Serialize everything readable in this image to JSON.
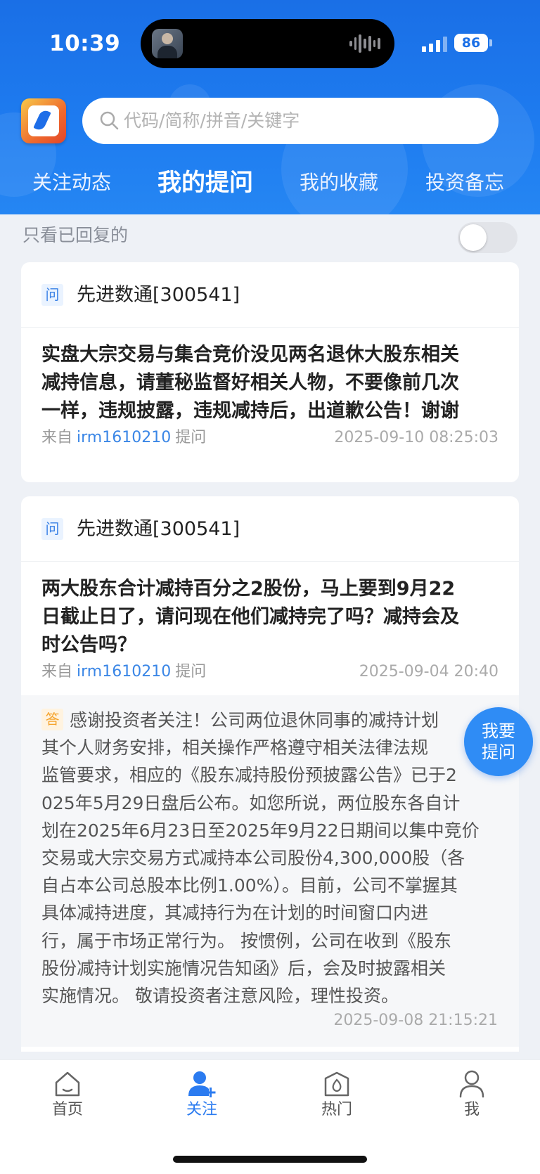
{
  "status_bar": {
    "time": "10:39",
    "battery": "86"
  },
  "search": {
    "placeholder": "代码/简称/拼音/关键字"
  },
  "tabs": [
    {
      "label": "关注动态"
    },
    {
      "label": "我的提问"
    },
    {
      "label": "我的收藏"
    },
    {
      "label": "投资备忘"
    }
  ],
  "filter": {
    "label": "只看已回复的",
    "enabled": false
  },
  "cards": [
    {
      "q_tag": "问",
      "company": "先进数通[300541]",
      "question_lines": [
        "实盘大宗交易与集合竞价没见两名退休大股东相关",
        "减持信息，请董秘监督好相关人物，不要像前几次",
        "一样，违规披露，违规减持后，出道歉公告！谢谢"
      ],
      "from_label": "来自",
      "user": "irm1610210",
      "action": "提问",
      "time": "2025-09-10 08:25:03"
    },
    {
      "q_tag": "问",
      "company": "先进数通[300541]",
      "question_lines": [
        "两大股东合计减持百分之2股份，马上要到9月22",
        "日截止日了，请问现在他们减持完了吗？减持会及",
        "时公告吗？"
      ],
      "from_label": "来自",
      "user": "irm1610210",
      "action": "提问",
      "time": "2025-09-04 20:40",
      "answer": {
        "tag": "答",
        "first": "感谢投资者关注！公司两位退休同事的减持计划",
        "lines": [
          "其个人财务安排，相关操作严格遵守相关法律法规",
          "监管要求，相应的《股东减持股份预披露公告》已于2",
          "025年5月29日盘后公布。如您所说，两位股东各自计",
          "划在2025年6月23日至2025年9月22日期间以集中竞价",
          "交易或大宗交易方式减持本公司股份4,300,000股（各",
          "自占本公司总股本比例1.00%）。目前，公司不掌握其",
          "具体减持进度，其减持行为在计划的时间窗口内进",
          "行，属于市场正常行为。 按惯例，公司在收到《股东",
          "股份减持计划实施情况告知函》后，会及时披露相关",
          "实施情况。 敬请投资者注意风险，理性投资。"
        ],
        "time": "2025-09-08 21:15:21"
      }
    }
  ],
  "fab": {
    "line1": "我要",
    "line2": "提问"
  },
  "bottom_nav": [
    {
      "label": "首页",
      "icon": "home-icon"
    },
    {
      "label": "关注",
      "icon": "follow-icon"
    },
    {
      "label": "热门",
      "icon": "hot-icon"
    },
    {
      "label": "我",
      "icon": "profile-icon"
    }
  ],
  "colors": {
    "primary": "#1e7cf0",
    "accent_text": "#2b7bf0",
    "answer_tag": "#f5a32b"
  }
}
